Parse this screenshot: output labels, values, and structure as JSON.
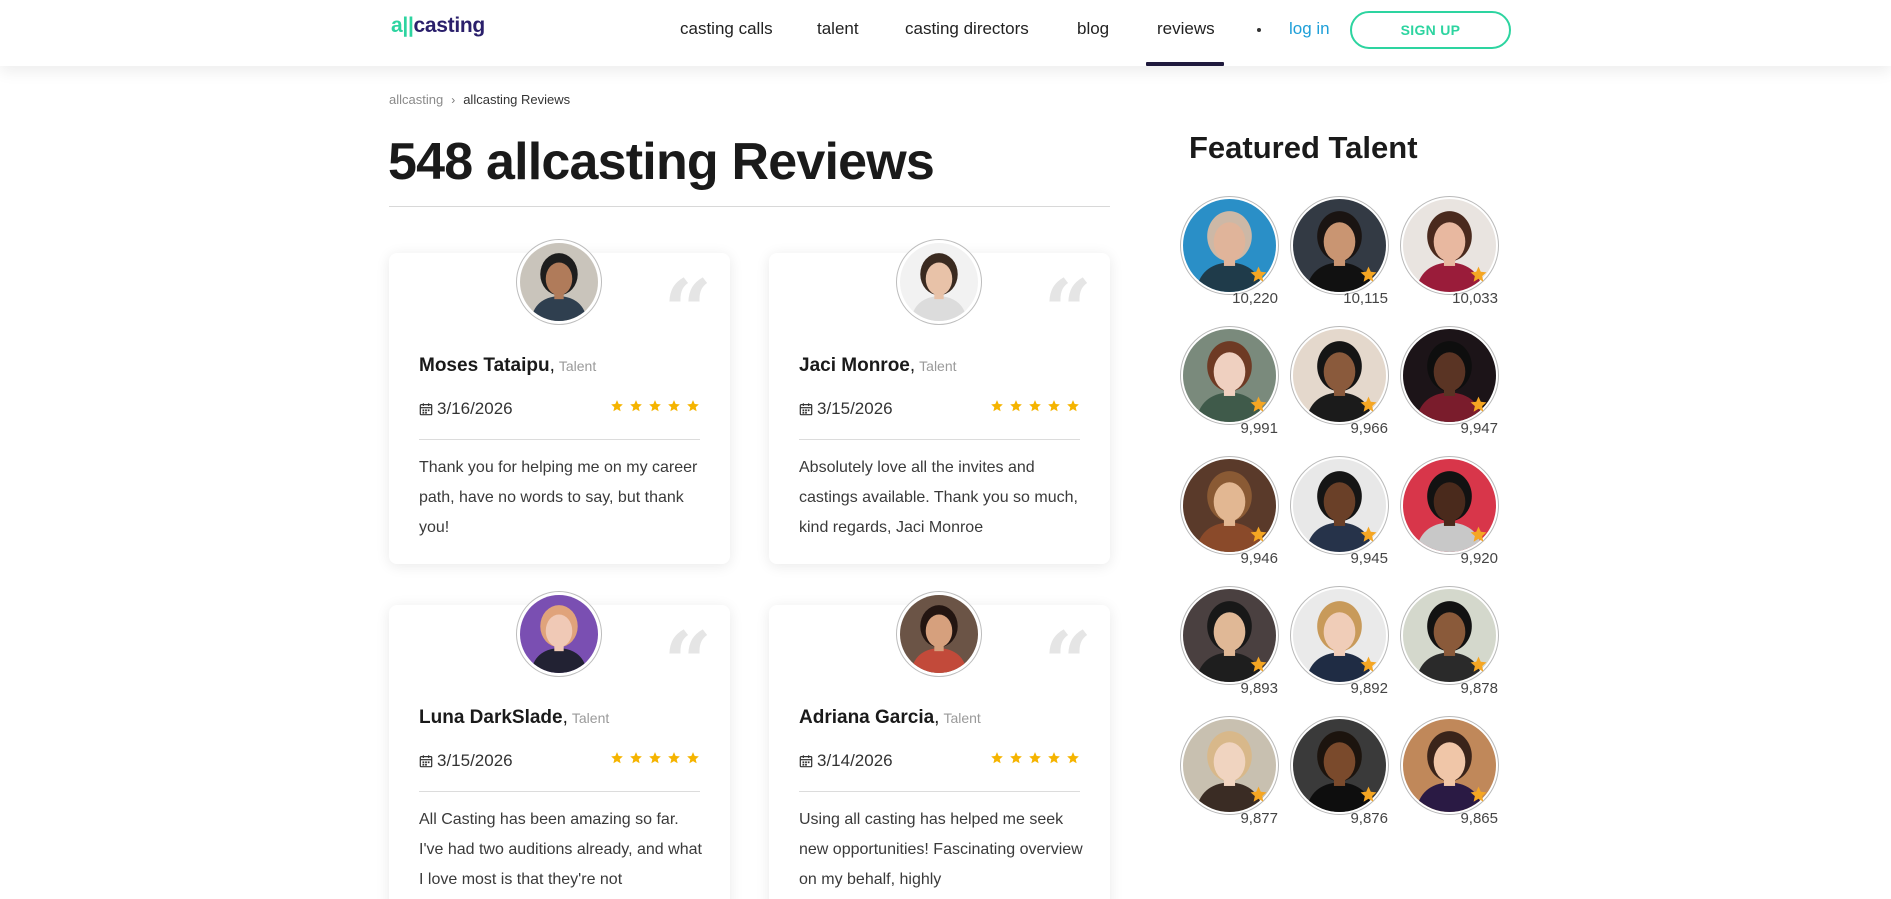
{
  "header": {
    "logo": {
      "bars": "a||",
      "rest": "casting"
    },
    "nav": [
      "casting calls",
      "talent",
      "casting directors",
      "blog",
      "reviews"
    ],
    "login": "log in",
    "signup": "SIGN UP",
    "colors": {
      "accent": "#2dd4a0",
      "link": "#1e9fd8",
      "logo": "#2a1f6b"
    }
  },
  "breadcrumb": {
    "root": "allcasting",
    "current": "allcasting Reviews"
  },
  "page_title": "548 allcasting Reviews",
  "reviews": [
    {
      "name": "Moses Tataipu",
      "role": "Talent",
      "date": "3/16/2026",
      "rating": 5,
      "text": "Thank you for helping me on my career path, have no words to say, but thank you!",
      "avatar_icon": "person-avatar-icon"
    },
    {
      "name": "Jaci Monroe",
      "role": "Talent",
      "date": "3/15/2026",
      "rating": 5,
      "text": "Absolutely love all the invites and castings available. Thank you so much, kind regards, Jaci Monroe",
      "avatar_icon": "person-avatar-icon"
    },
    {
      "name": "Luna DarkSlade",
      "role": "Talent",
      "date": "3/15/2026",
      "rating": 5,
      "text": "All Casting has been amazing so far. I've had two auditions already, and what I love most is that they're not",
      "avatar_icon": "person-avatar-icon"
    },
    {
      "name": "Adriana Garcia",
      "role": "Talent",
      "date": "3/14/2026",
      "rating": 5,
      "text": "Using all casting has helped me seek new opportunities! Fascinating overview on my behalf, highly",
      "avatar_icon": "person-avatar-icon"
    }
  ],
  "featured": {
    "title": "Featured Talent",
    "talent": [
      {
        "count": "10,220"
      },
      {
        "count": "10,115"
      },
      {
        "count": "10,033"
      },
      {
        "count": "9,991"
      },
      {
        "count": "9,966"
      },
      {
        "count": "9,947"
      },
      {
        "count": "9,946"
      },
      {
        "count": "9,945"
      },
      {
        "count": "9,920"
      },
      {
        "count": "9,893"
      },
      {
        "count": "9,892"
      },
      {
        "count": "9,878"
      },
      {
        "count": "9,877"
      },
      {
        "count": "9,876"
      },
      {
        "count": "9,865"
      }
    ]
  }
}
